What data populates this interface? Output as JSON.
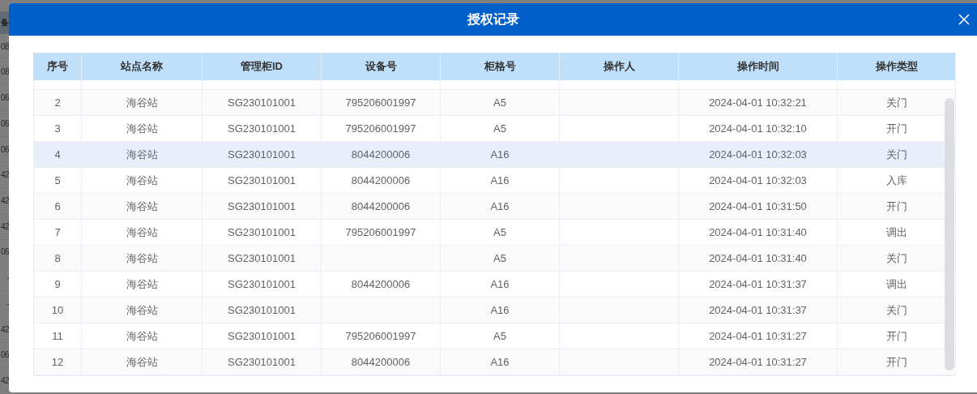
{
  "background_table": {
    "header": "备",
    "cells": [
      "08",
      "08",
      "06",
      "06",
      "06",
      "42",
      "42",
      "42",
      "06",
      "-",
      "-",
      "42",
      "06",
      "42"
    ]
  },
  "dialog": {
    "title": "授权记录",
    "table": {
      "columns": [
        "序号",
        "站点名称",
        "管理柜ID",
        "设备号",
        "柜格号",
        "操作人",
        "操作时间",
        "操作类型"
      ],
      "rows": [
        {
          "index": "2",
          "station": "海谷站",
          "cabinet_id": "SG230101001",
          "device": "795206001997",
          "slot": "A5",
          "time": "2024-04-01 10:32:21",
          "type": "关门",
          "selected": false
        },
        {
          "index": "3",
          "station": "海谷站",
          "cabinet_id": "SG230101001",
          "device": "795206001997",
          "slot": "A5",
          "time": "2024-04-01 10:32:10",
          "type": "开门",
          "selected": false
        },
        {
          "index": "4",
          "station": "海谷站",
          "cabinet_id": "SG230101001",
          "device": "8044200006",
          "slot": "A16",
          "time": "2024-04-01 10:32:03",
          "type": "关门",
          "selected": true
        },
        {
          "index": "5",
          "station": "海谷站",
          "cabinet_id": "SG230101001",
          "device": "8044200006",
          "slot": "A16",
          "time": "2024-04-01 10:32:03",
          "type": "入库",
          "selected": false
        },
        {
          "index": "6",
          "station": "海谷站",
          "cabinet_id": "SG230101001",
          "device": "8044200006",
          "slot": "A16",
          "time": "2024-04-01 10:31:50",
          "type": "开门",
          "selected": false
        },
        {
          "index": "7",
          "station": "海谷站",
          "cabinet_id": "SG230101001",
          "device": "795206001997",
          "slot": "A5",
          "time": "2024-04-01 10:31:40",
          "type": "调出",
          "selected": false
        },
        {
          "index": "8",
          "station": "海谷站",
          "cabinet_id": "SG230101001",
          "slot": "A5",
          "time": "2024-04-01 10:31:40",
          "type": "关门",
          "selected": false
        },
        {
          "index": "9",
          "station": "海谷站",
          "cabinet_id": "SG230101001",
          "device": "8044200006",
          "slot": "A16",
          "time": "2024-04-01 10:31:37",
          "type": "调出",
          "selected": false
        },
        {
          "index": "10",
          "station": "海谷站",
          "cabinet_id": "SG230101001",
          "slot": "A16",
          "time": "2024-04-01 10:31:37",
          "type": "关门",
          "selected": false
        },
        {
          "index": "11",
          "station": "海谷站",
          "cabinet_id": "SG230101001",
          "device": "795206001997",
          "slot": "A5",
          "time": "2024-04-01 10:31:27",
          "type": "开门",
          "selected": false
        },
        {
          "index": "12",
          "station": "海谷站",
          "cabinet_id": "SG230101001",
          "device": "8044200006",
          "slot": "A16",
          "time": "2024-04-01 10:31:27",
          "type": "开门",
          "selected": false
        }
      ]
    }
  }
}
